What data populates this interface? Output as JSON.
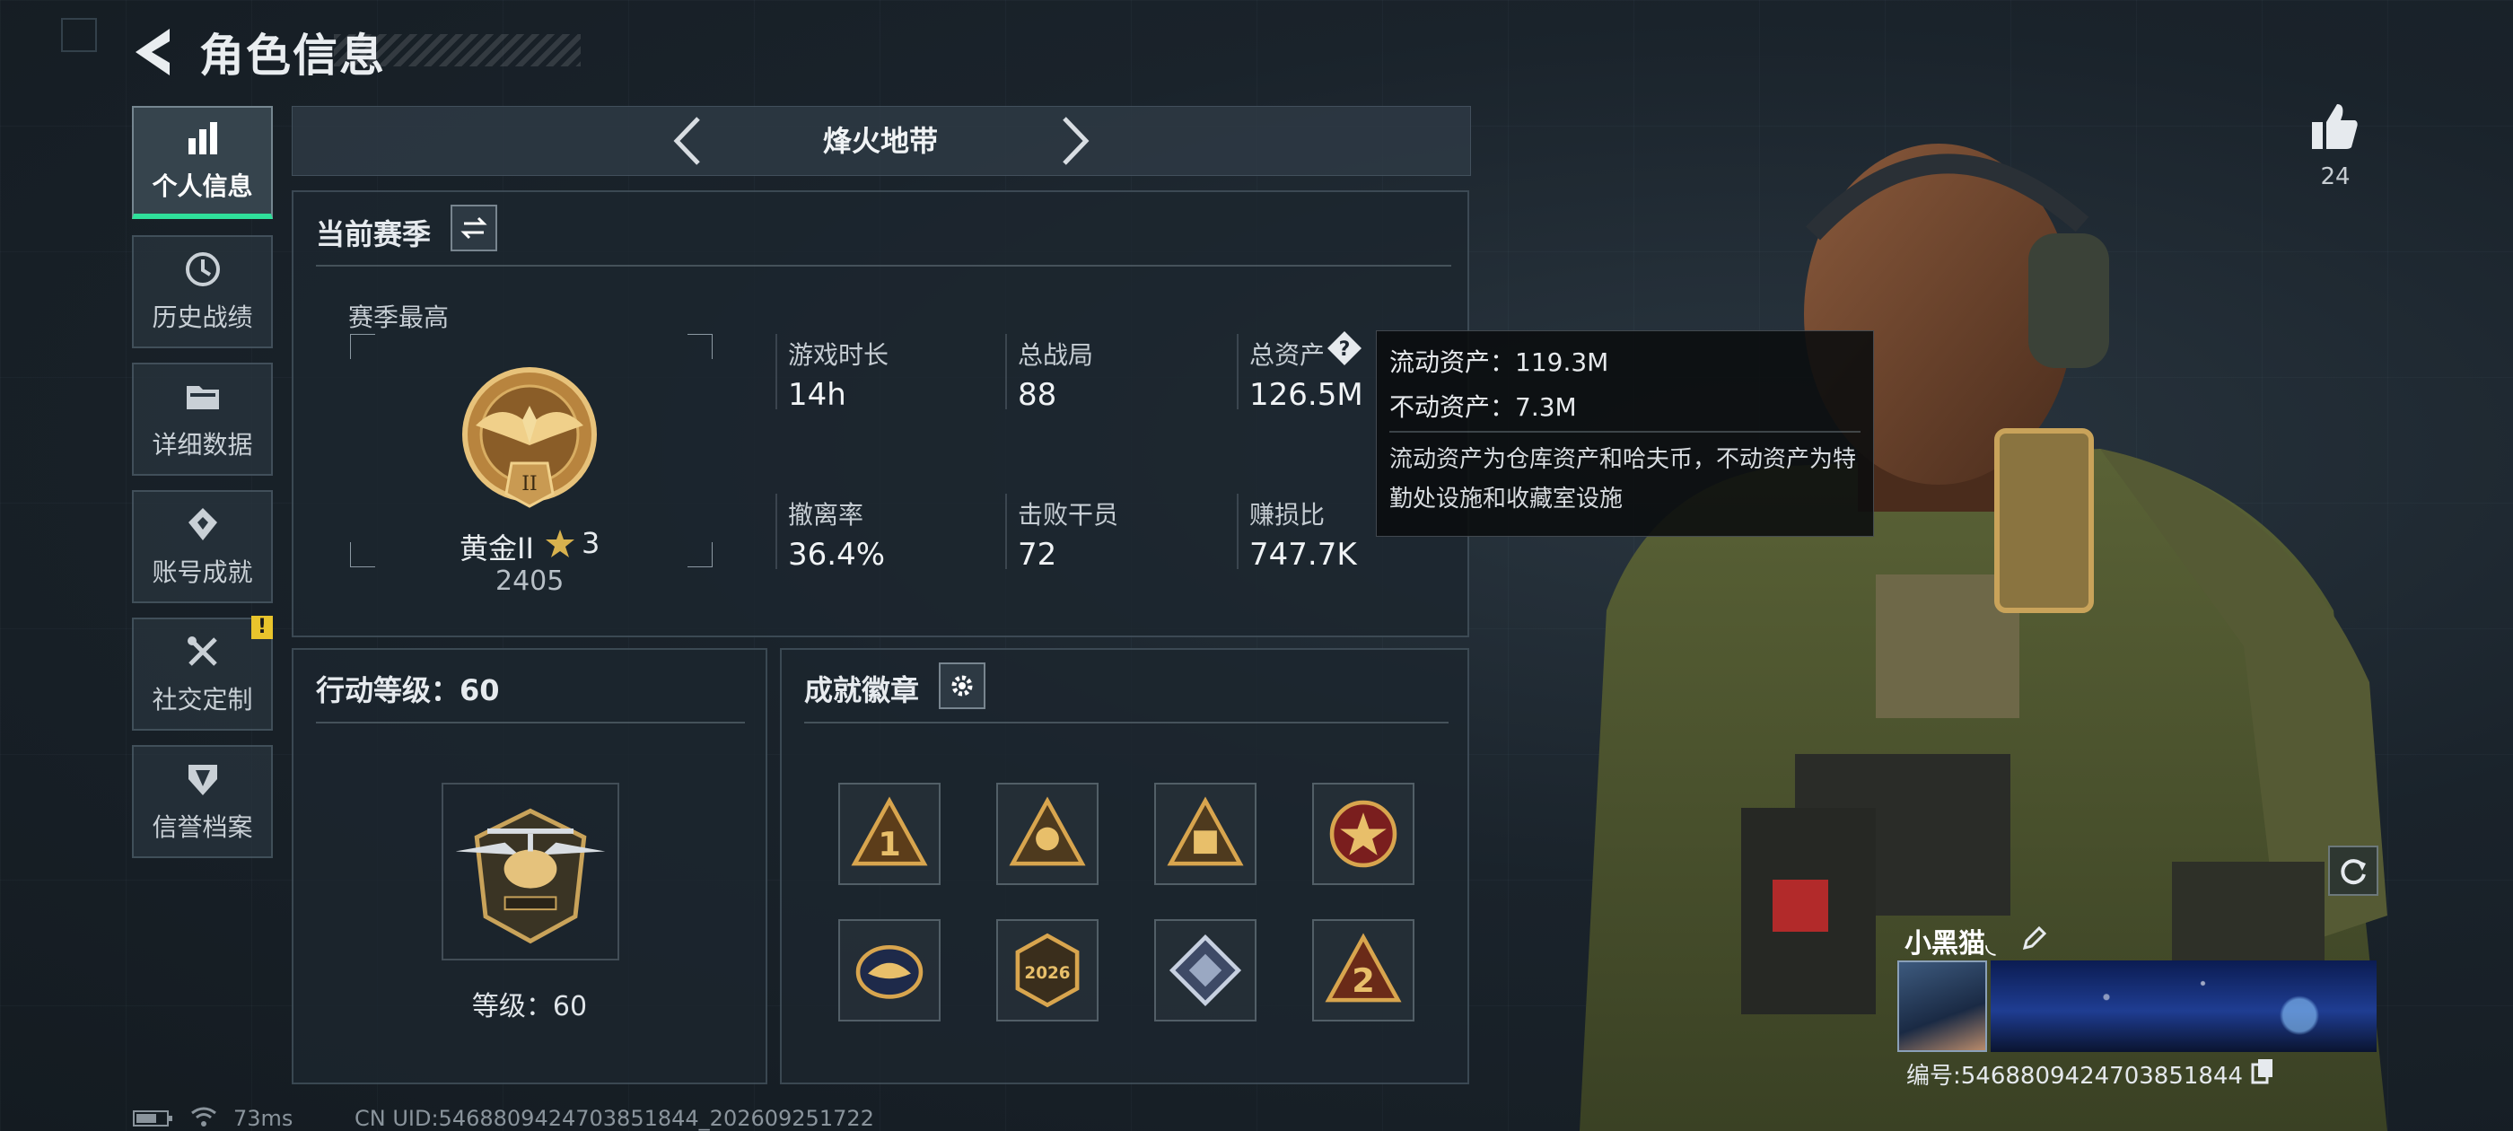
{
  "header": {
    "title": "角色信息"
  },
  "sidebar": {
    "items": [
      {
        "label": "个人信息",
        "icon": "bar-chart-icon",
        "active": true
      },
      {
        "label": "历史战绩",
        "icon": "history-icon"
      },
      {
        "label": "详细数据",
        "icon": "folder-icon"
      },
      {
        "label": "账号成就",
        "icon": "achievement-icon"
      },
      {
        "label": "社交定制",
        "icon": "tools-icon",
        "badge": "!"
      },
      {
        "label": "信誉档案",
        "icon": "credit-shield-icon"
      }
    ]
  },
  "mode": {
    "title": "烽火地带"
  },
  "season": {
    "heading": "当前赛季",
    "best_label": "赛季最高",
    "rank_name": "黄金II",
    "rank_stars": "3",
    "rank_score": "2405",
    "stats": [
      {
        "label": "游戏时长",
        "value": "14h"
      },
      {
        "label": "总战局",
        "value": "88"
      },
      {
        "label": "总资产",
        "value": "126.5M"
      },
      {
        "label": "撤离率",
        "value": "36.4%"
      },
      {
        "label": "击败干员",
        "value": "72"
      },
      {
        "label": "赚损比",
        "value": "747.7K"
      }
    ]
  },
  "tooltip": {
    "liquid": "流动资产：119.3M",
    "fixed": "不动资产：7.3M",
    "desc": "流动资产为仓库资产和哈夫币，不动资产为特勤处设施和收藏室设施"
  },
  "level": {
    "heading": "行动等级：60",
    "caption": "等级：60"
  },
  "badges": {
    "heading": "成就徽章",
    "items": [
      "badge-1-icon",
      "badge-2-icon",
      "badge-3-icon",
      "badge-4-icon",
      "badge-5-icon",
      "badge-6-icon",
      "badge-7-icon",
      "badge-8-icon"
    ]
  },
  "profile": {
    "likes": "24",
    "nickname": "小黑猫◟",
    "uid_line": "编号:5468809424703851844"
  },
  "status_bar": {
    "ping": "73ms",
    "uid": "CN UID:5468809424703851844_202609251722"
  },
  "colors": {
    "accent": "#2fe09b",
    "warning": "#e9c42c",
    "gold": "#c9a35a"
  }
}
